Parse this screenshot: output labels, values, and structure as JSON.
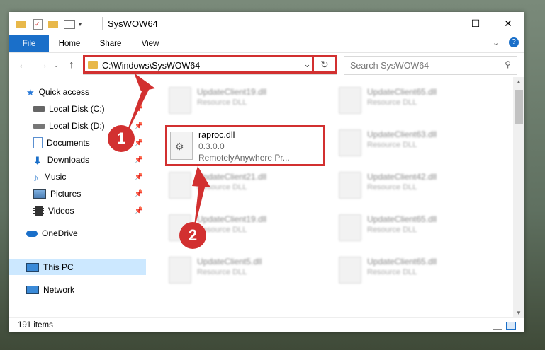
{
  "window": {
    "title": "SysWOW64",
    "minimize": "—",
    "maximize": "☐",
    "close": "✕",
    "help": "?"
  },
  "ribbon": {
    "tabs": [
      "File",
      "Home",
      "Share",
      "View"
    ]
  },
  "address": {
    "path": "C:\\Windows\\SysWOW64",
    "search_placeholder": "Search SysWOW64"
  },
  "navigation": {
    "items": [
      {
        "label": "Quick access",
        "icon": "star-icon",
        "pinned": false
      },
      {
        "label": "Local Disk (C:)",
        "icon": "drive-icon",
        "pinned": true
      },
      {
        "label": "Local Disk (D:)",
        "icon": "drive-icon",
        "pinned": true
      },
      {
        "label": "Documents",
        "icon": "documents-icon",
        "pinned": true
      },
      {
        "label": "Downloads",
        "icon": "download-icon",
        "pinned": true
      },
      {
        "label": "Music",
        "icon": "music-icon",
        "pinned": true
      },
      {
        "label": "Pictures",
        "icon": "pictures-icon",
        "pinned": true
      },
      {
        "label": "Videos",
        "icon": "videos-icon",
        "pinned": true
      },
      {
        "label": "OneDrive",
        "icon": "cloud-icon",
        "pinned": false
      },
      {
        "label": "This PC",
        "icon": "computer-icon",
        "pinned": false
      },
      {
        "label": "Network",
        "icon": "network-icon",
        "pinned": false
      }
    ]
  },
  "files": {
    "selected": {
      "name": "raproc.dll",
      "version": "0.3.0.0",
      "company": "RemotelyAnywhere Pr..."
    },
    "others": [
      {
        "name": "UpdateClient19.dll",
        "type": "Resource DLL"
      },
      {
        "name": "UpdateClient65.dll",
        "type": "Resource DLL"
      },
      {
        "name": "UpdateClient63.dll",
        "type": "Resource DLL"
      },
      {
        "name": "UpdateClient21.dll",
        "type": "Resource DLL"
      },
      {
        "name": "UpdateClient42.dll",
        "type": "Resource DLL"
      },
      {
        "name": "UpdateClient19.dll",
        "type": "Resource DLL"
      },
      {
        "name": "UpdateClient65.dll",
        "type": "Resource DLL"
      },
      {
        "name": "UpdateClient5.dll",
        "type": "Resource DLL"
      },
      {
        "name": "UpdateClient65.dll",
        "type": "Resource DLL"
      }
    ]
  },
  "status": {
    "count": "191 items"
  },
  "annotations": {
    "step1": "1",
    "step2": "2"
  },
  "colors": {
    "accent": "#1a6fc9",
    "highlight": "#d23030",
    "selected_nav": "#cce8ff"
  }
}
